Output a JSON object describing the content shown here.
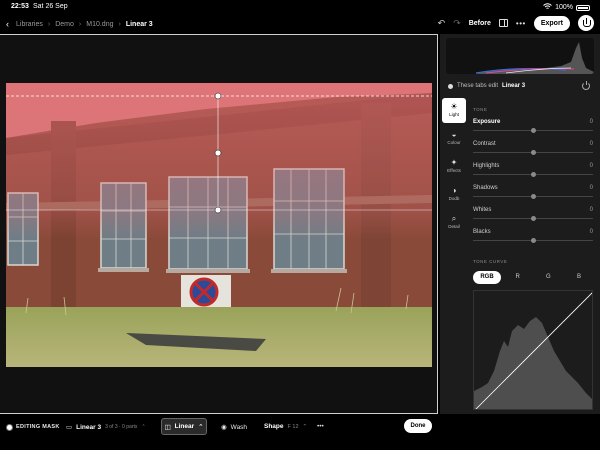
{
  "status": {
    "time": "22:53",
    "date": "Sat 26 Sep",
    "battery": "100%",
    "wifi_icon": "wifi-icon"
  },
  "header": {
    "breadcrumbs": [
      "Libraries",
      "Demo",
      "M10.dng"
    ],
    "current": "Linear 3",
    "before_label": "Before",
    "export_label": "Export",
    "more_label": "•••"
  },
  "panel": {
    "edit_note_prefix": "These tabs edit",
    "edit_note_target": "Linear 3",
    "tabs": [
      {
        "label": "Light",
        "icon": "sun-icon",
        "glyph": "☀",
        "active": true
      },
      {
        "label": "Colour",
        "icon": "drop-icon",
        "glyph": "◐",
        "active": false
      },
      {
        "label": "Effects",
        "icon": "sparkle-icon",
        "glyph": "✦",
        "active": false
      },
      {
        "label": "Dodge & Burn",
        "display": "Dodb",
        "icon": "half-circle-icon",
        "glyph": "◑",
        "active": false
      },
      {
        "label": "Detail",
        "icon": "magnifier-icon",
        "glyph": "⌕",
        "active": false
      }
    ],
    "tone_label": "TONE",
    "sliders": [
      {
        "name": "Exposure",
        "value": "0",
        "level": 0.5
      },
      {
        "name": "Contrast",
        "value": "0",
        "level": 0.5
      },
      {
        "name": "Highlights",
        "value": "0",
        "level": 0.5
      },
      {
        "name": "Shadows",
        "value": "0",
        "level": 0.5
      },
      {
        "name": "Whites",
        "value": "0",
        "level": 0.5
      },
      {
        "name": "Blacks",
        "value": "0",
        "level": 0.5
      }
    ],
    "tone_curve_label": "TONE CURVE",
    "curve_tabs": [
      "RGB",
      "R",
      "G",
      "B"
    ]
  },
  "bottom": {
    "editing_mask": "EDITING MASK",
    "mask_name": "Linear 3",
    "mask_sub": "3 of 3 · 0 parts",
    "linear_label": "Linear",
    "wash_label": "Wash",
    "shape_label": "Shape",
    "shape_value": "F 12",
    "more_label": "•••",
    "done_label": "Done"
  },
  "colors": {
    "accent_white": "#ffffff",
    "panel_bg": "#1c1c1c",
    "mask_overlay": "#e26a72"
  }
}
